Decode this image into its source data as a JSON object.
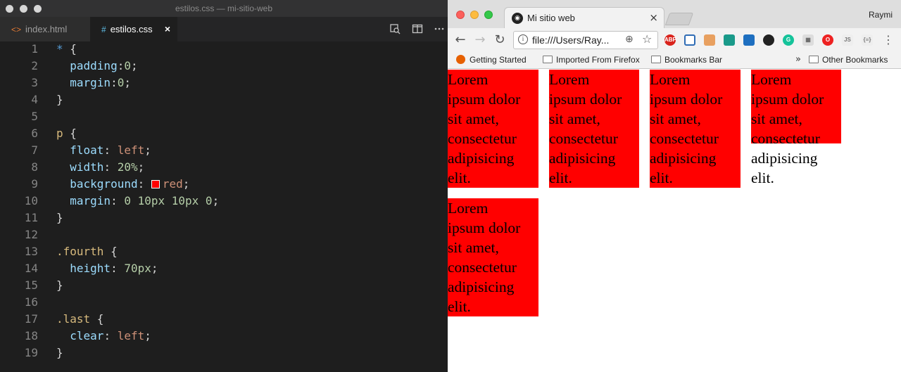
{
  "editor": {
    "window_title": "estilos.css — mi-sitio-web",
    "tabs": [
      {
        "icon": "html-file-icon",
        "glyph": "<>",
        "label": "index.html"
      },
      {
        "icon": "css-file-icon",
        "glyph": "#",
        "label": "estilos.css",
        "close": "×"
      }
    ],
    "line_numbers": [
      "1",
      "2",
      "3",
      "4",
      "5",
      "6",
      "7",
      "8",
      "9",
      "10",
      "11",
      "12",
      "13",
      "14",
      "15",
      "16",
      "17",
      "18",
      "19"
    ],
    "code": {
      "l1_sel": "*",
      "l1_brace": " {",
      "l2_prop": "padding",
      "l2_colon": ":",
      "l2_val": "0",
      "l2_semi": ";",
      "l3_prop": "margin",
      "l3_colon": ":",
      "l3_val": "0",
      "l3_semi": ";",
      "l4": "}",
      "l6_sel": "p",
      "l6_brace": " {",
      "l7_prop": "float",
      "l7_colon": ": ",
      "l7_val": "left",
      "l7_semi": ";",
      "l8_prop": "width",
      "l8_colon": ": ",
      "l8_val": "20%",
      "l8_semi": ";",
      "l9_prop": "background",
      "l9_colon": ": ",
      "l9_val": "red",
      "l9_semi": ";",
      "l10_prop": "margin",
      "l10_colon": ": ",
      "l10_val": "0 10px 10px 0",
      "l10_semi": ";",
      "l11": "}",
      "l13_sel": ".fourth",
      "l13_brace": " {",
      "l14_prop": "height",
      "l14_colon": ": ",
      "l14_val": "70px",
      "l14_semi": ";",
      "l15": "}",
      "l17_sel": ".last",
      "l17_brace": " {",
      "l18_prop": "clear",
      "l18_colon": ": ",
      "l18_val": "left",
      "l18_semi": ";",
      "l19": "}"
    },
    "colors": {
      "background": "#1e1e1e",
      "selector": "#d7ba7d",
      "property": "#9cdcfe",
      "number": "#b5cea8",
      "value": "#ce9178"
    }
  },
  "browser": {
    "tab_title": "Mi sitio web",
    "tab_close": "×",
    "user_name": "Raymi",
    "url": "file:///Users/Ray...",
    "extensions": [
      "ABP",
      "JS",
      "{≡}"
    ],
    "bookmarks": [
      "Getting Started",
      "Imported From Firefox",
      "Bookmarks Bar"
    ],
    "bookmarks_more": "»",
    "other_bookmarks": "Other Bookmarks",
    "paragraph_text": "Lorem ipsum dolor sit amet, consectetur adipisicing elit.",
    "paragraph_lines": [
      "Lorem",
      "ipsum dolor",
      "sit amet,",
      "consectetur",
      "adipisicing",
      "elit."
    ],
    "paragraph_color": "#ff0000"
  }
}
